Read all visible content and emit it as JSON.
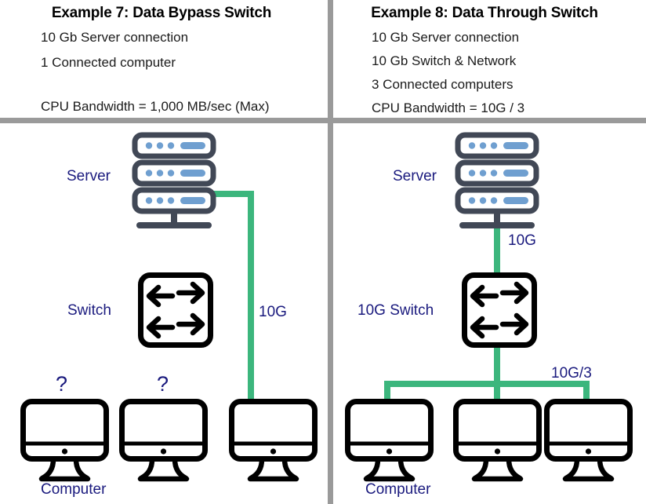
{
  "theme": {
    "divider_color": "#9a9a9a",
    "cable_color": "#3cb67d",
    "label_color": "#1a1a7e",
    "icon_dark": "#414856",
    "icon_blue": "#6f9fd0",
    "outline_black": "#000000",
    "background": "#ffffff"
  },
  "panels": {
    "left": {
      "title": "Example 7: Data Bypass Switch",
      "lines": [
        "10 Gb Server connection",
        "1 Connected computer",
        "CPU Bandwidth = 1,000 MB/sec (Max)"
      ],
      "labels": {
        "server": "Server",
        "switch": "Switch",
        "computer": "Computer",
        "cable": "10G",
        "unknown_1": "?",
        "unknown_2": "?"
      }
    },
    "right": {
      "title": "Example 8: Data Through Switch",
      "lines": [
        "10 Gb Server connection",
        "10 Gb Switch & Network",
        "3 Connected computers",
        "CPU Bandwidth = 10G / 3"
      ],
      "labels": {
        "server": "Server",
        "switch": "10G Switch",
        "computer": "Computer",
        "cable_uplink": "10G",
        "cable_downlink": "10G/3"
      }
    }
  }
}
